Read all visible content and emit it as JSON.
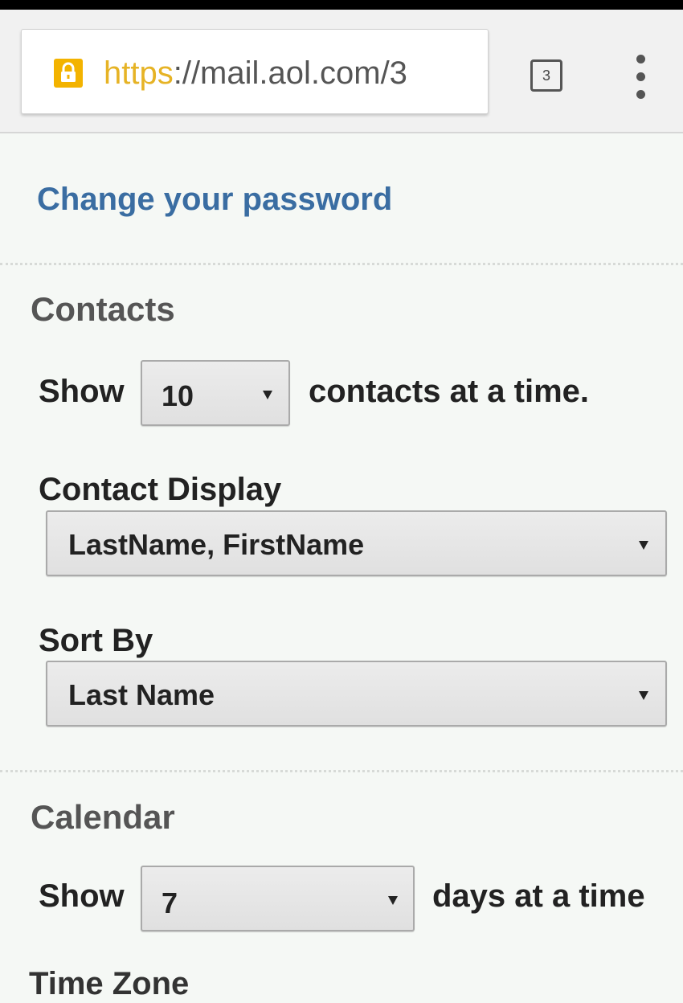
{
  "browser": {
    "url_scheme": "https",
    "url_rest": "://mail.aol.com/3",
    "tab_count": "3",
    "lock_color": "#f3b300",
    "lock_icon": "lock-icon",
    "menu_icon": "overflow-menu-icon"
  },
  "page": {
    "change_password_link": "Change your password",
    "link_color": "#3a6da2"
  },
  "contacts": {
    "heading": "Contacts",
    "show_label": "Show",
    "per_page_value": "10",
    "per_page_suffix": "contacts at a time.",
    "display_label": "Contact Display",
    "display_value": "LastName, FirstName",
    "sort_label": "Sort By",
    "sort_value": "Last Name"
  },
  "calendar": {
    "heading": "Calendar",
    "show_label": "Show",
    "days_value": "7",
    "days_suffix": "days at a time",
    "next_label": "Time Zone"
  }
}
